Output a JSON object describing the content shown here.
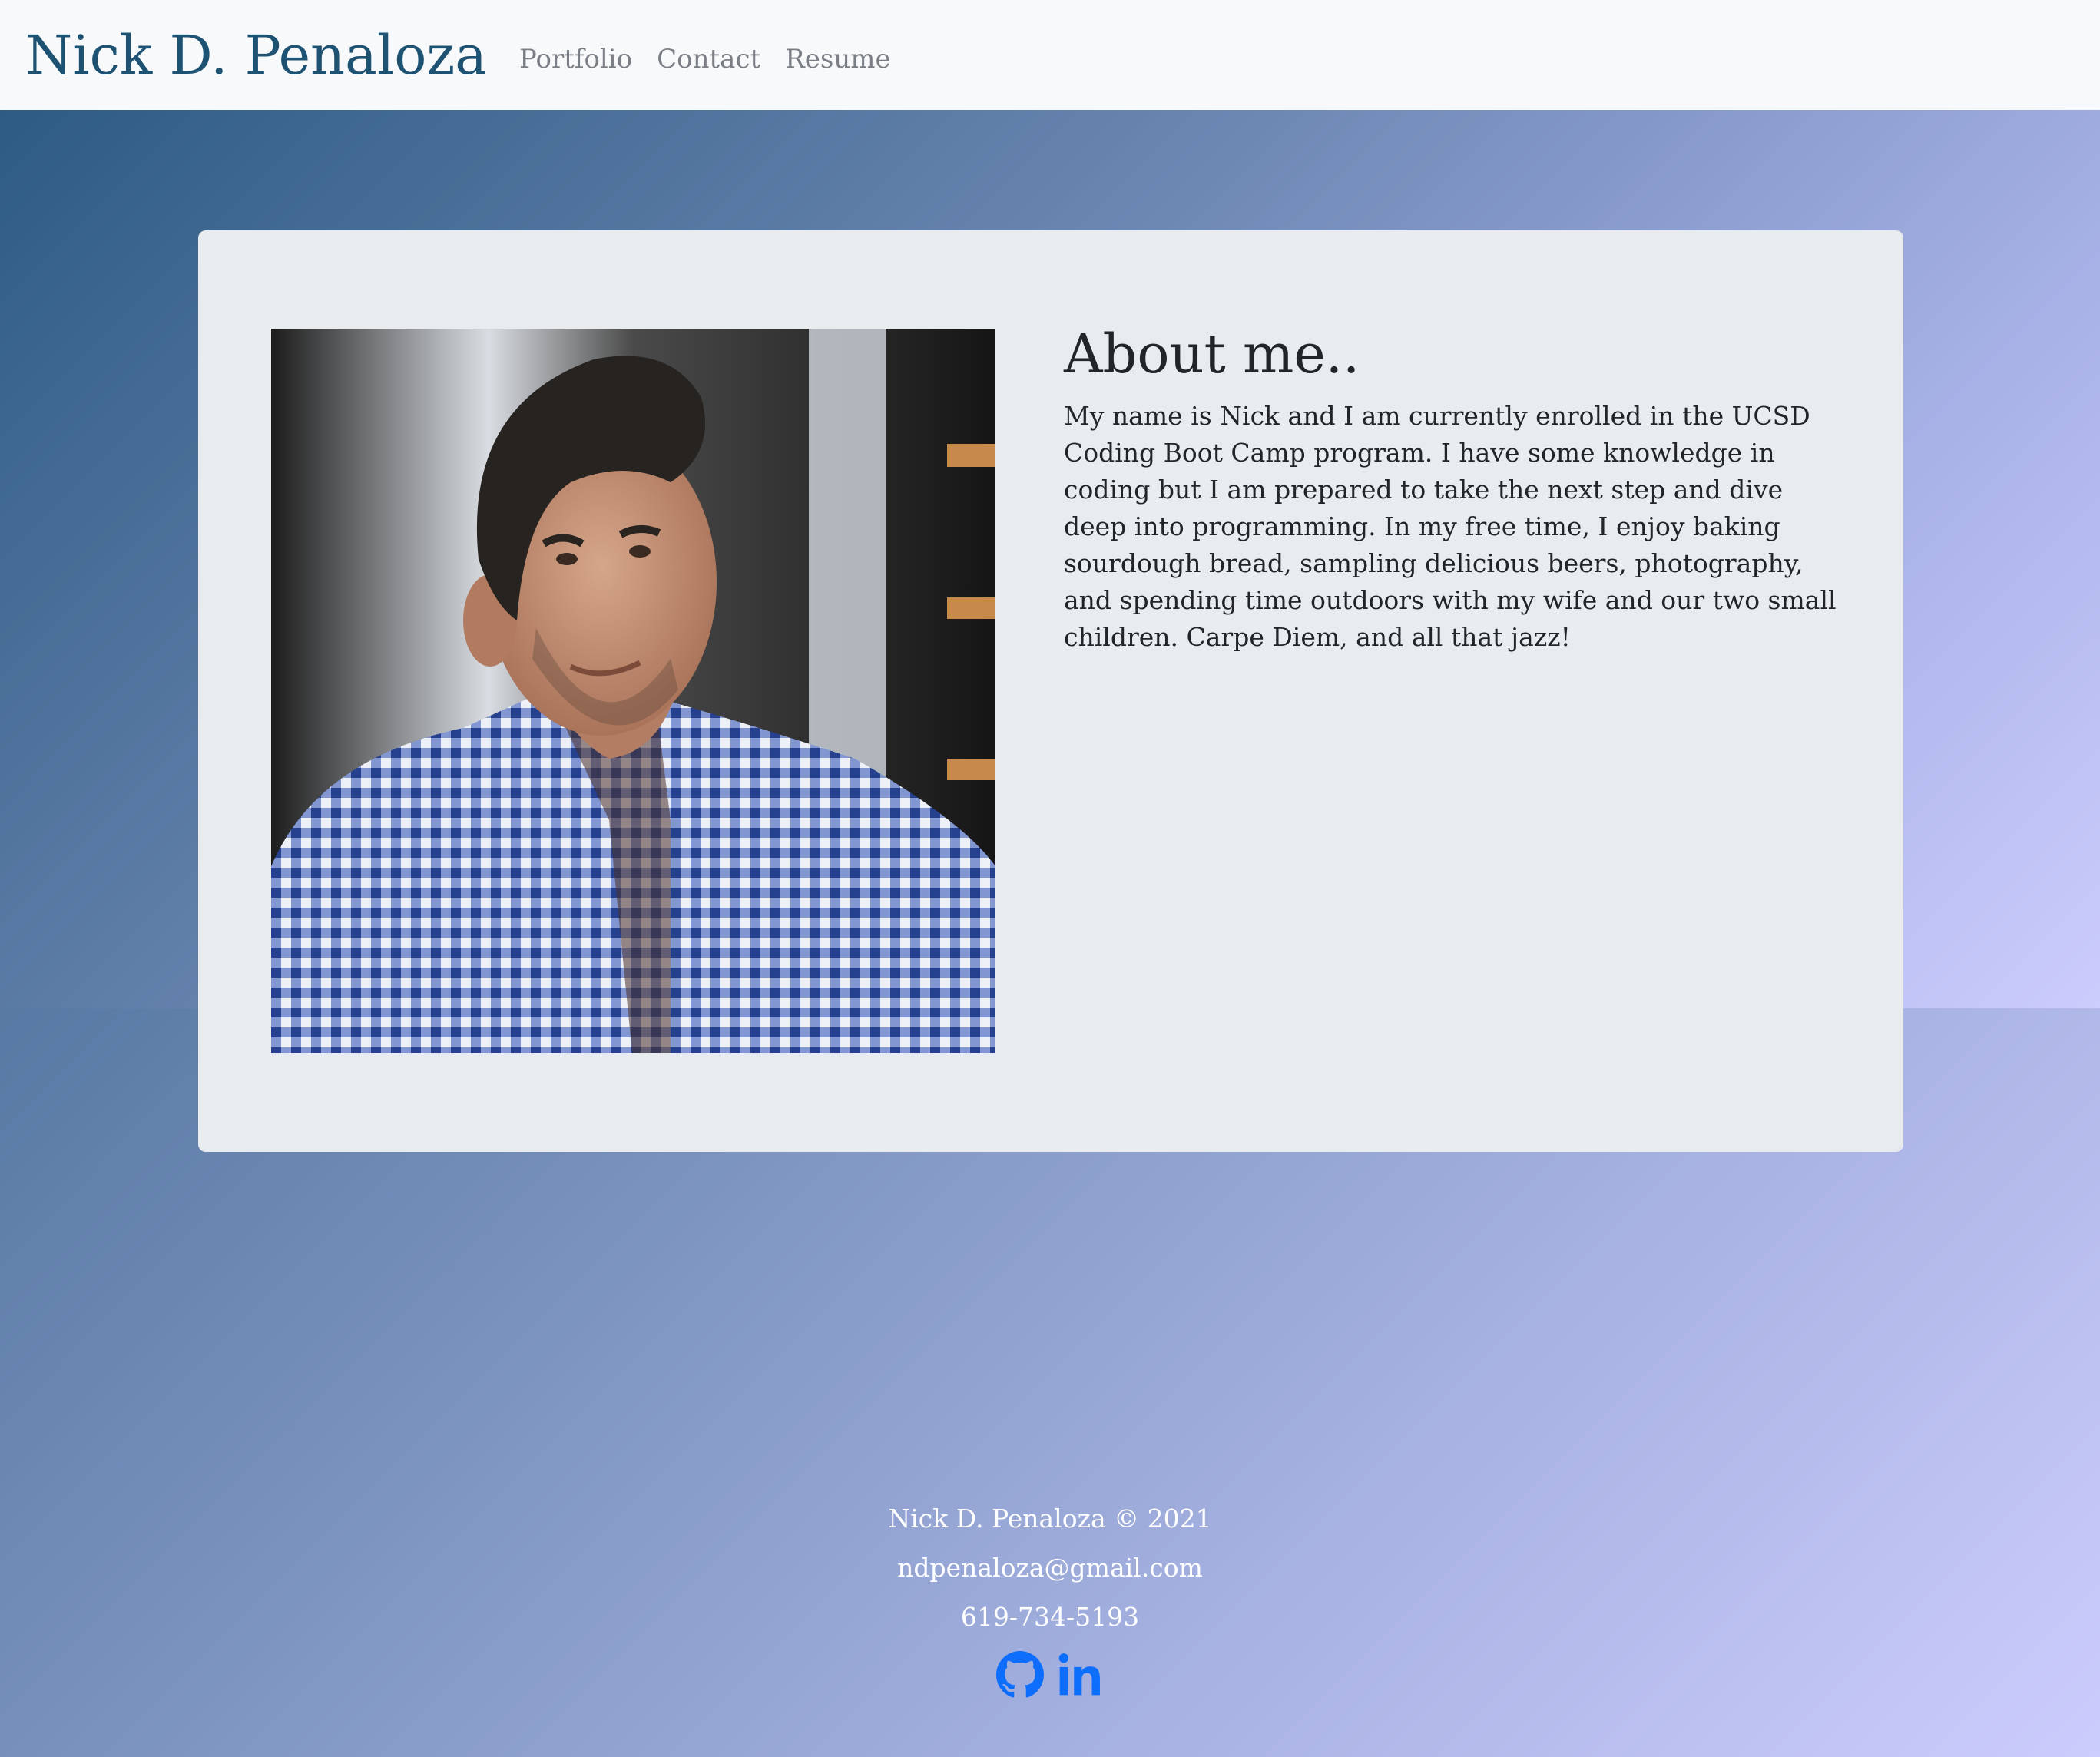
{
  "nav": {
    "brand": "Nick D. Penaloza",
    "links": [
      "Portfolio",
      "Contact",
      "Resume"
    ]
  },
  "about": {
    "title": "About me..",
    "text": "My name is Nick and I am currently enrolled in the UCSD Coding Boot Camp program. I have some knowledge in coding but I am prepared to take the next step and dive deep into programming. In my free time, I enjoy baking sourdough bread, sampling delicious beers, photography, and spending time outdoors with my wife and our two small children. Carpe Diem, and all that jazz!",
    "photo_label": "photo of Nick D. Penaloza"
  },
  "footer": {
    "copyright": "Nick D. Penaloza © 2021",
    "email": "ndpenaloza@gmail.com",
    "phone": "619-734-5193",
    "icons": [
      "github-icon",
      "linkedin-icon"
    ]
  },
  "colors": {
    "brand": "#1e5272",
    "navbar_bg": "#f8f9fa",
    "card_bg": "#e9ecef",
    "icon_blue": "#0d6efd",
    "gradient_start": "#2d5b82",
    "gradient_end": "#ccccfd"
  }
}
